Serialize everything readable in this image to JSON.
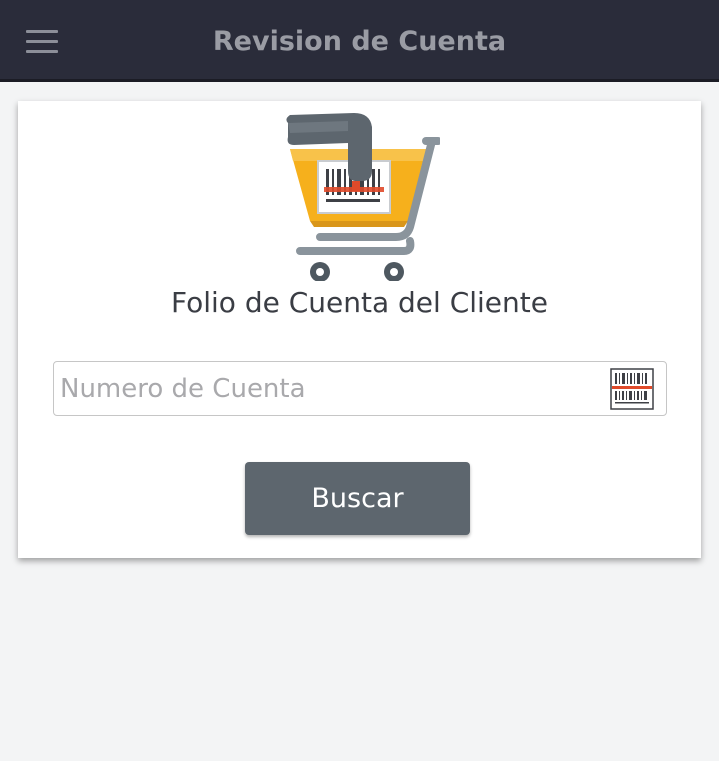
{
  "app_bar": {
    "title": "Revision de Cuenta",
    "menu_icon": "hamburger-menu-icon"
  },
  "card": {
    "illustration_icon": "shopping-cart-barcode-scanner-icon",
    "title": "Folio de Cuenta del Cliente",
    "account_input": {
      "placeholder": "Numero de Cuenta",
      "value": ""
    },
    "scan_icon": "barcode-scan-icon",
    "search_button_label": "Buscar"
  },
  "colors": {
    "app_bar_bg": "#2a2c3a",
    "page_bg": "#f3f4f5",
    "button_bg": "#5d666e",
    "cart_orange": "#f6b01c",
    "scanner_gray": "#5d666e",
    "scan_line_red": "#e04a2a"
  }
}
